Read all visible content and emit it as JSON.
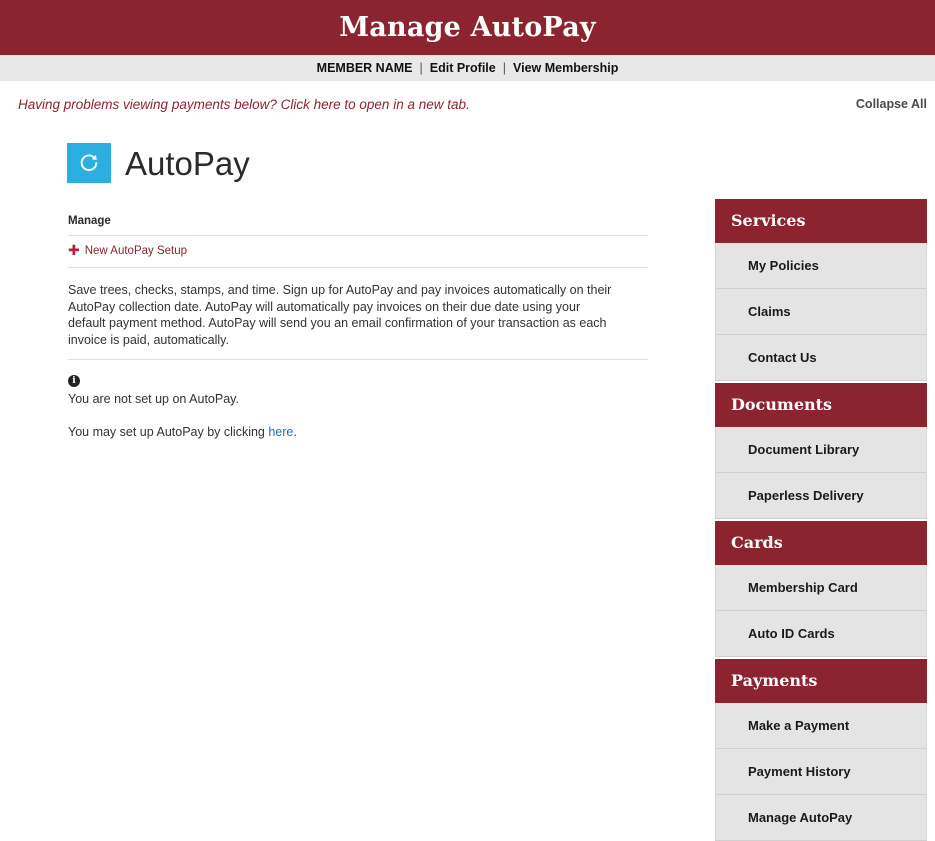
{
  "header": {
    "title": "Manage AutoPay"
  },
  "member_bar": {
    "member_name": "MEMBER NAME",
    "separator": "|",
    "edit_profile": "Edit Profile",
    "view_membership": "View Membership"
  },
  "notice": {
    "text": "Having problems viewing payments below? Click here to open in a new tab."
  },
  "collapse_all": {
    "label": "Collapse All"
  },
  "main": {
    "icon_name": "refresh-icon",
    "title": "AutoPay",
    "section_label": "Manage",
    "new_setup_link": "New AutoPay Setup",
    "plus_glyph": "✚",
    "paragraph": "Save trees, checks, stamps, and time. Sign up for AutoPay and pay invoices automatically on their AutoPay collection date. AutoPay will automatically pay invoices on their due date using your default payment method. AutoPay will send you an email confirmation of your transaction as each invoice is paid, automatically.",
    "info_glyph": "i",
    "status_text": "You are not set up on AutoPay.",
    "setup_hint_prefix": "You may set up AutoPay by clicking ",
    "setup_hint_link": "here",
    "setup_hint_suffix": "."
  },
  "sidebar": {
    "sections": [
      {
        "title": "Services",
        "items": [
          "My Policies",
          "Claims",
          "Contact Us"
        ]
      },
      {
        "title": "Documents",
        "items": [
          "Document Library",
          "Paperless Delivery"
        ]
      },
      {
        "title": "Cards",
        "items": [
          "Membership Card",
          "Auto ID Cards"
        ]
      },
      {
        "title": "Payments",
        "items": [
          "Make a Payment",
          "Payment History",
          "Manage AutoPay"
        ]
      }
    ]
  },
  "colors": {
    "brand_maroon": "#8c2430",
    "accent_cyan": "#2baee0",
    "nav_gray": "#e8e8e8",
    "item_gray": "#e4e4e4",
    "link_blue": "#2a6fb5"
  }
}
